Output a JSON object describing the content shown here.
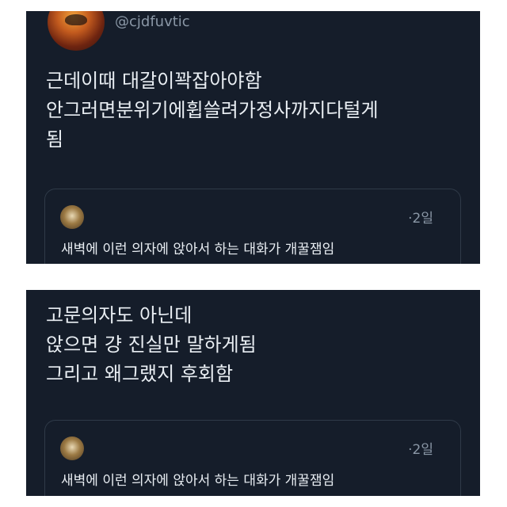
{
  "tweet_1": {
    "handle": "@cjdfuvtic",
    "text": "근데이때 대갈이꽉잡아야함\n안그러면분위기에휩쓸려가정사까지다털게\n됨",
    "quote": {
      "time": "·2일",
      "text": "새벽에 이런 의자에 앉아서 하는 대화가 개꿀잼임"
    }
  },
  "tweet_2": {
    "text": "고문의자도 아닌데\n앉으면 걍 진실만 말하게됨\n그리고 왜그랬지 후회함",
    "quote": {
      "time": "·2일",
      "text": "새벽에 이런 의자에 앉아서 하는 대화가 개꿀잼임"
    }
  },
  "colors": {
    "background": "#151d2a",
    "text": "#e9eef3",
    "muted": "#8a97a6",
    "border": "#2f3a48"
  }
}
